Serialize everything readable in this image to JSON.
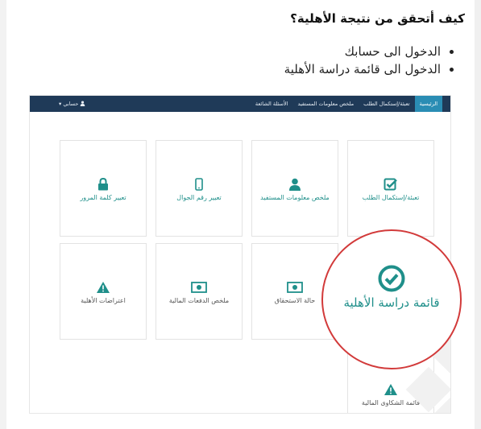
{
  "heading": "كيف أتحقق من نتيجة الأهلية؟",
  "steps": [
    "الدخول الى حسابك",
    "الدخول الى قائمة دراسة الأهلية"
  ],
  "navbar": {
    "items": [
      "الرئيسية",
      "تعبئة/إستكمال الطلب",
      "ملخص معلومات المستفيد",
      "الأسئلة الشائعة"
    ],
    "account": "حسابي"
  },
  "tiles": [
    {
      "label": "تعبئة/إستكمال الطلب",
      "icon": "edit-check-icon"
    },
    {
      "label": "ملخص معلومات المستفيد",
      "icon": "user-icon"
    },
    {
      "label": "تعيير رقم الجوال",
      "icon": "mobile-icon"
    },
    {
      "label": "تعيير كلمة المرور",
      "icon": "lock-icon"
    },
    {
      "label": "قائمة دراسة الأهلية",
      "icon": "check-circle-icon"
    },
    {
      "label": "حالة الاستحقاق",
      "icon": "money-icon"
    },
    {
      "label": "ملخص الدفعات المالية",
      "icon": "money-icon"
    },
    {
      "label": "اعتراضات الأهلية",
      "icon": "warning-icon"
    },
    {
      "label": "قائمة الشكاوى المالية",
      "icon": "warning-icon"
    }
  ],
  "colors": {
    "navbar": "#1f3a58",
    "nav_active": "#2a8db4",
    "teal": "#1f8f8a",
    "highlight_circle": "#d23a3a"
  }
}
